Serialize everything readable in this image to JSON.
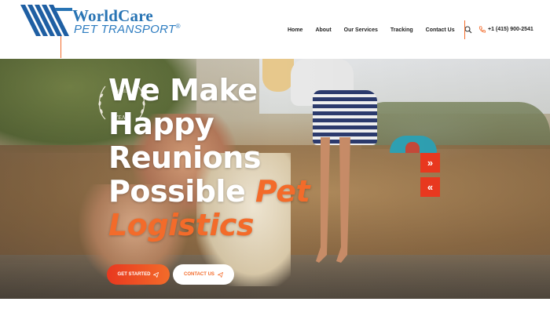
{
  "header": {
    "logo": {
      "brand": "WorldCare",
      "tagline": "PET TRANSPORT",
      "registered": "®"
    },
    "nav": [
      {
        "label": "Home"
      },
      {
        "label": "About"
      },
      {
        "label": "Our Services"
      },
      {
        "label": "Tracking"
      },
      {
        "label": "Contact Us"
      }
    ],
    "search_icon": "search-icon",
    "phone": "+1 (415) 900-2541",
    "phone_icon": "phone-icon"
  },
  "hero": {
    "headline": {
      "line1": "We Make",
      "line2": "Happy",
      "line3": "Reunions",
      "line4_white": "Possible ",
      "line4_accent": "Pet",
      "line5_accent": "Logistics"
    },
    "seal": {
      "top": "WORLD",
      "bottom": "YEAR"
    },
    "buttons": {
      "get_started": "GET STARTED",
      "contact_us": "CONTACT US"
    },
    "slider": {
      "next": "»",
      "prev": "«"
    }
  },
  "colors": {
    "accent": "#f36b2a",
    "accent_dark": "#e8381f",
    "brand_blue": "#2874b4"
  }
}
